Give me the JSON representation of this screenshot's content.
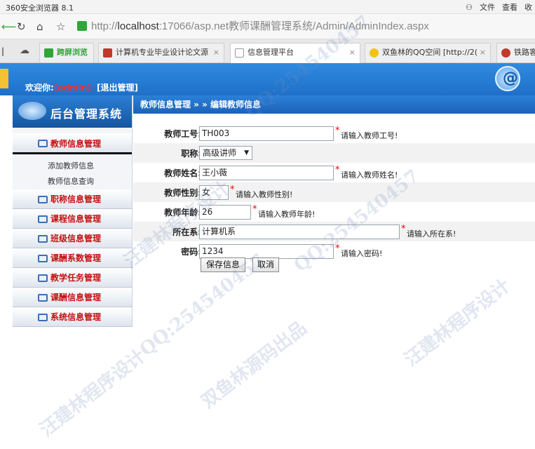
{
  "browser": {
    "app_name": "360安全浏览器 8.1",
    "menu_file": "文件",
    "menu_view": "查看",
    "menu_more": "收",
    "url_prefix": "http://",
    "url_host": "localhost",
    "url_rest": ":17066/asp.net教师课酬管理系统/Admin/AdminIndex.aspx",
    "tabs": [
      {
        "label": "跨屏浏览",
        "icon_color": "#2fa53a"
      },
      {
        "label": "计算机专业毕业设计论文源",
        "icon_color": "#c0392b"
      },
      {
        "label": "信息管理平台",
        "icon_color": "#bbbbbb"
      },
      {
        "label": "双鱼林的QQ空间 [http://2(",
        "icon_color": "#f1c40f"
      },
      {
        "label": "铁路客",
        "icon_color": "#c0392b"
      }
    ]
  },
  "header": {
    "welcome": "欢迎你:",
    "username": "[admin]",
    "logout": "[退出管理]"
  },
  "sidebar": {
    "title": "后台管理系统",
    "menus": [
      {
        "label": "教师信息管理",
        "sub": [
          "添加教师信息",
          "教师信息查询"
        ]
      },
      {
        "label": "职称信息管理"
      },
      {
        "label": "课程信息管理"
      },
      {
        "label": "班级信息管理"
      },
      {
        "label": "课酬系数管理"
      },
      {
        "label": "教学任务管理"
      },
      {
        "label": "课酬信息管理"
      },
      {
        "label": "系统信息管理"
      }
    ]
  },
  "content": {
    "breadcrumb": "教师信息管理 » » 编辑教师信息",
    "fields": {
      "teacher_no": {
        "label": "教师工号:",
        "value": "TH003",
        "hint": "请输入教师工号!"
      },
      "title": {
        "label": "职称:",
        "value": "高级讲师"
      },
      "name": {
        "label": "教师姓名:",
        "value": "王小薇",
        "hint": "请输入教师姓名!"
      },
      "gender": {
        "label": "教师性别:",
        "value": "女",
        "hint": "请输入教师性别!"
      },
      "age": {
        "label": "教师年龄:",
        "value": "26",
        "hint": "请输入教师年龄!"
      },
      "dept": {
        "label": "所在系:",
        "value": "计算机系",
        "hint": "请输入所在系!"
      },
      "password": {
        "label": "密码:",
        "value": "1234",
        "hint": "请输入密码!"
      }
    },
    "save_label": "保存信息",
    "cancel_label": "取消"
  },
  "watermarks": [
    "QQ:254540457",
    "汪建林程序设计",
    "双鱼林源码出品"
  ]
}
